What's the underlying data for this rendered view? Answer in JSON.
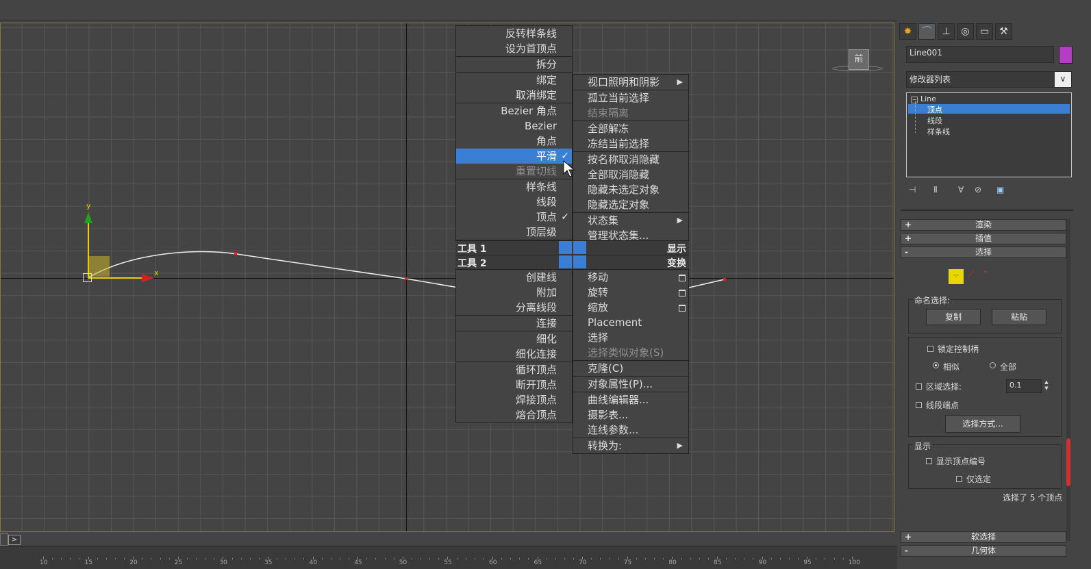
{
  "viewport": {
    "label": "前",
    "axes": {
      "x": "x",
      "y": "y"
    }
  },
  "quad_left_top": [
    {
      "label": "反转样条线",
      "disabled": false
    },
    {
      "label": "设为首顶点",
      "disabled": false
    },
    {
      "label": "拆分",
      "disabled": false,
      "sep": true
    },
    {
      "label": "绑定",
      "disabled": false,
      "sep": true
    },
    {
      "label": "取消绑定",
      "disabled": false
    },
    {
      "label": "Bezier 角点",
      "disabled": false,
      "sep": true
    },
    {
      "label": "Bezier",
      "disabled": false
    },
    {
      "label": "角点",
      "disabled": false
    },
    {
      "label": "平滑",
      "disabled": false,
      "highlight": true,
      "checked": true
    },
    {
      "label": "重置切线",
      "disabled": true
    },
    {
      "label": "样条线",
      "disabled": false,
      "sep": true
    },
    {
      "label": "线段",
      "disabled": false
    },
    {
      "label": "顶点",
      "disabled": false,
      "checked": true
    },
    {
      "label": "顶层级",
      "disabled": false
    }
  ],
  "quad_right_top": [
    {
      "label": "视口照明和阴影",
      "submenu": true
    },
    {
      "label": "孤立当前选择",
      "sep": true
    },
    {
      "label": "结束隔离",
      "disabled": true
    },
    {
      "label": "全部解冻",
      "sep": true
    },
    {
      "label": "冻结当前选择"
    },
    {
      "label": "按名称取消隐藏",
      "sep": true
    },
    {
      "label": "全部取消隐藏"
    },
    {
      "label": "隐藏未选定对象"
    },
    {
      "label": "隐藏选定对象"
    },
    {
      "label": "状态集",
      "submenu": true,
      "sep": true
    },
    {
      "label": "管理状态集..."
    }
  ],
  "quad_headers": {
    "tools1": "工具 1",
    "tools2": "工具 2",
    "display": "显示",
    "transform": "变换"
  },
  "quad_left_bottom": [
    {
      "label": "创建线"
    },
    {
      "label": "附加"
    },
    {
      "label": "分离线段"
    },
    {
      "label": "连接",
      "sep": true
    },
    {
      "label": "细化",
      "sep": true
    },
    {
      "label": "细化连接"
    },
    {
      "label": "循环顶点",
      "sep": true
    },
    {
      "label": "断开顶点"
    },
    {
      "label": "焊接顶点"
    },
    {
      "label": "熔合顶点"
    }
  ],
  "quad_right_bottom": [
    {
      "label": "移动",
      "box": true
    },
    {
      "label": "旋转",
      "box": true
    },
    {
      "label": "缩放",
      "box": true
    },
    {
      "label": "Placement"
    },
    {
      "label": "选择"
    },
    {
      "label": "选择类似对象(S)",
      "disabled": true
    },
    {
      "label": "克隆(C)",
      "sep": true
    },
    {
      "label": "对象属性(P)...",
      "sep": true
    },
    {
      "label": "曲线编辑器...",
      "sep": true
    },
    {
      "label": "摄影表..."
    },
    {
      "label": "连线参数..."
    },
    {
      "label": "转换为:",
      "submenu": true,
      "sep": true
    }
  ],
  "panel": {
    "tabs": [
      "create-icon",
      "modify-icon",
      "hierarchy-icon",
      "motion-icon",
      "display-icon",
      "utilities-icon"
    ],
    "object_name": "Line001",
    "object_color": "#b63cc8",
    "modifier_list": "修改器列表",
    "stack": {
      "root": "Line",
      "items": [
        "顶点",
        "线段",
        "样条线"
      ],
      "selected": 0
    },
    "rollouts": {
      "render": "渲染",
      "interpolation": "插值",
      "selection": "选择",
      "soft_selection": "软选择",
      "geometry": "几何体"
    },
    "named_selection": {
      "label": "命名选择:",
      "copy": "复制",
      "paste": "粘贴"
    },
    "lock_handles": "锁定控制柄",
    "alike": "相似",
    "all": "全部",
    "area_selection": "区域选择:",
    "area_value": "0.1",
    "segment_end": "线段端点",
    "select_by": "选择方式...",
    "display_group": "显示",
    "show_vertex_numbers": "显示顶点编号",
    "selected_only": "仅选定",
    "status": "选择了 5 个顶点"
  },
  "timeline": {
    "nav_button": ">",
    "ticks": [
      "10",
      "15",
      "20",
      "25",
      "30",
      "35",
      "40",
      "45",
      "50",
      "55",
      "60",
      "65",
      "70",
      "75",
      "80",
      "85",
      "90",
      "95",
      "100"
    ]
  },
  "colors": {
    "highlight": "#3b7fd5",
    "viewport_border": "#8a7a3a",
    "object_color": "#b63cc8"
  }
}
